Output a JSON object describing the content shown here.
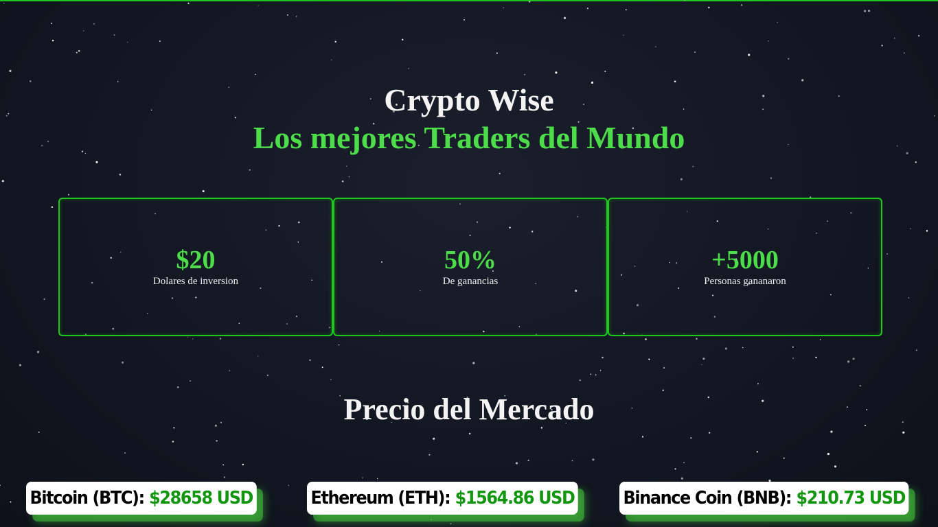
{
  "hero": {
    "title": "Crypto Wise",
    "subtitle": "Los mejores Traders del Mundo"
  },
  "stats": [
    {
      "value": "$20",
      "label": "Dolares de inversion"
    },
    {
      "value": "50%",
      "label": "De ganancias"
    },
    {
      "value": "+5000",
      "label": "Personas gananaron"
    }
  ],
  "market": {
    "title": "Precio del Mercado",
    "prices": [
      {
        "name": "Bitcoin (BTC):",
        "price": "$28658 USD"
      },
      {
        "name": "Ethereum (ETH):",
        "price": "$1564.86 USD"
      },
      {
        "name": "Binance Coin (BNB):",
        "price": "$210.73 USD"
      }
    ]
  },
  "colors": {
    "accent_green": "#4ddc4a",
    "border_green": "#1ec81b",
    "price_green": "#129610",
    "background": "#121722"
  }
}
